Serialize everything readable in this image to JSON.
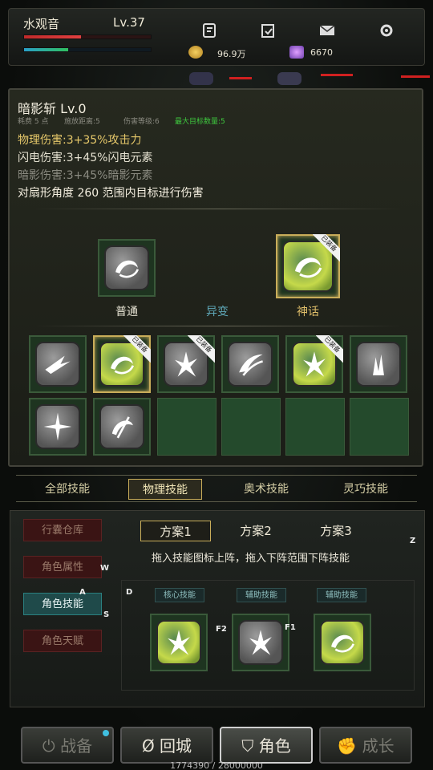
{
  "player": {
    "name": "水观音",
    "level": "Lv.37",
    "hp_fraction": 0.45,
    "mp_fraction": 0.35
  },
  "currency": {
    "gold": "96.9万",
    "gems": "6670"
  },
  "top_icons": [
    "skill-book-icon",
    "clipboard-icon",
    "mail-icon",
    "gear-icon"
  ],
  "skill": {
    "name": "暗影斩 Lv.0",
    "sub": [
      "耗费 5 点",
      "施放距离:5",
      "伤害等级:6",
      "最大目标数量:5"
    ],
    "lines": [
      "物理伤害:3+35%攻击力",
      "闪电伤害:3+45%闪电元素",
      "暗影伤害:3+45%暗影元素",
      "对扇形角度 260 范围内目标进行伤害"
    ],
    "colors": [
      "#e6c86a",
      "#e6e2d2",
      "#8a8a80",
      "#f4efe0"
    ]
  },
  "tiers": [
    {
      "label": "普通",
      "color": "#f0ead8"
    },
    {
      "label": "异变",
      "color": "#5fa8b8"
    },
    {
      "label": "神话",
      "color": "#e0bf6a",
      "badge": "已装备"
    }
  ],
  "badge_text": "已装备",
  "category_tabs": [
    "全部技能",
    "物理技能",
    "奥术技能",
    "灵巧技能"
  ],
  "side_menu": [
    "行囊仓库",
    "角色属性",
    "角色技能",
    "角色天赋"
  ],
  "plans": [
    "方案1",
    "方案2",
    "方案3"
  ],
  "hint": "拖入技能图标上阵，拖入下阵范围下阵技能",
  "loadout_labels": [
    "核心技能",
    "辅助技能",
    "辅助技能"
  ],
  "keys": {
    "w": "W",
    "a": "A",
    "s": "S",
    "d": "D",
    "z": "Z",
    "f1": "F1",
    "f2": "F2"
  },
  "dock": [
    "战备",
    "回城",
    "角色",
    "成长"
  ],
  "exp": "1774390 / 28000000"
}
